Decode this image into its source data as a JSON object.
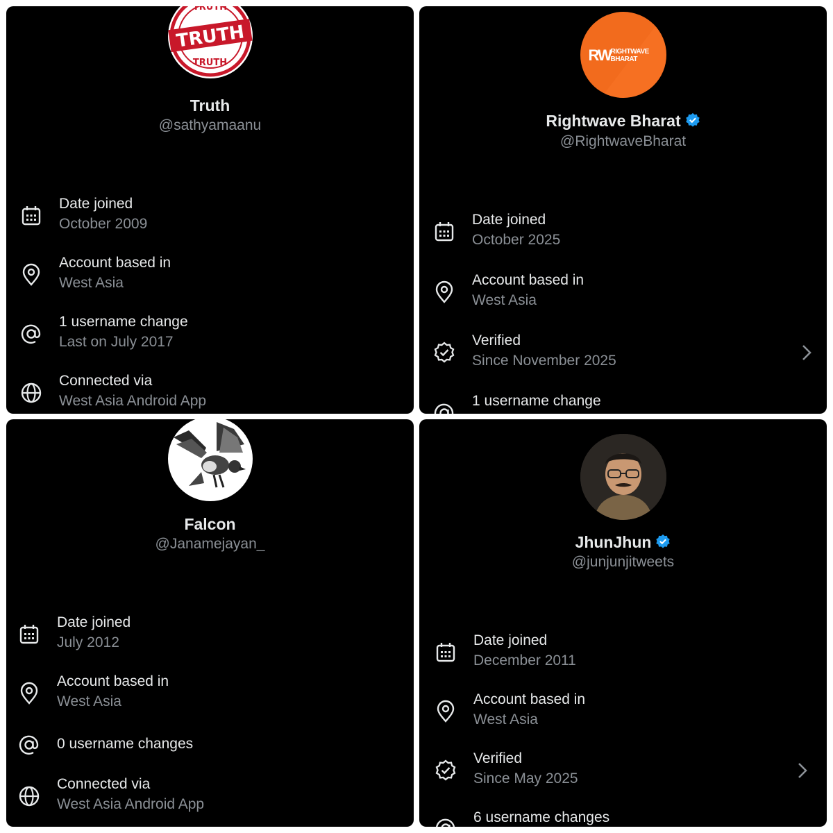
{
  "panels": [
    {
      "name": "Truth",
      "handle": "@sathyamaanu",
      "avatar": {
        "icon": "truth-stamp-avatar",
        "stamp_main": "TRUTH",
        "stamp_top": "TRUTH",
        "stamp_bottom": "TRUTH"
      },
      "verified": false,
      "rows": [
        {
          "icon": "calendar-icon",
          "title": "Date joined",
          "subtitle": "October 2009"
        },
        {
          "icon": "location-pin-icon",
          "title": "Account based in",
          "subtitle": "West Asia"
        },
        {
          "icon": "at-sign-icon",
          "title": "1 username change",
          "subtitle": "Last on July 2017"
        },
        {
          "icon": "globe-icon",
          "title": "Connected via",
          "subtitle": "West Asia Android App"
        }
      ]
    },
    {
      "name": "Rightwave Bharat",
      "handle": "@RightwaveBharat",
      "avatar": {
        "icon": "rightwave-logo-avatar",
        "mark": "RW",
        "line1": "RIGHTWAVE",
        "line2": "BHARAT",
        "color": "#f26b1d"
      },
      "verified": true,
      "rows": [
        {
          "icon": "calendar-icon",
          "title": "Date joined",
          "subtitle": "October 2025"
        },
        {
          "icon": "location-pin-icon",
          "title": "Account based in",
          "subtitle": "West Asia"
        },
        {
          "icon": "verified-badge-icon",
          "title": "Verified",
          "subtitle": "Since November 2025"
        },
        {
          "icon": "at-sign-icon",
          "title": "1 username change",
          "subtitle": ""
        }
      ]
    },
    {
      "name": "Falcon",
      "handle": "@Janamejayan_",
      "avatar": {
        "icon": "falcon-illustration-avatar"
      },
      "verified": false,
      "rows": [
        {
          "icon": "calendar-icon",
          "title": "Date joined",
          "subtitle": "July 2012"
        },
        {
          "icon": "location-pin-icon",
          "title": "Account based in",
          "subtitle": "West Asia"
        },
        {
          "icon": "at-sign-icon",
          "title": "0 username changes",
          "subtitle": ""
        },
        {
          "icon": "globe-icon",
          "title": "Connected via",
          "subtitle": "West Asia Android App"
        }
      ]
    },
    {
      "name": "JhunJhun",
      "handle": "@junjunjitweets",
      "avatar": {
        "icon": "person-photo-avatar"
      },
      "verified": true,
      "rows": [
        {
          "icon": "calendar-icon",
          "title": "Date joined",
          "subtitle": "December 2011"
        },
        {
          "icon": "location-pin-icon",
          "title": "Account based in",
          "subtitle": "West Asia"
        },
        {
          "icon": "verified-badge-icon",
          "title": "Verified",
          "subtitle": "Since May 2025"
        },
        {
          "icon": "at-sign-icon",
          "title": "6 username changes",
          "subtitle": ""
        }
      ]
    }
  ],
  "colors": {
    "background": "#000000",
    "primary_text": "#e7e9ea",
    "secondary_text": "#8b9096",
    "verified_blue": "#1d9bf0"
  }
}
